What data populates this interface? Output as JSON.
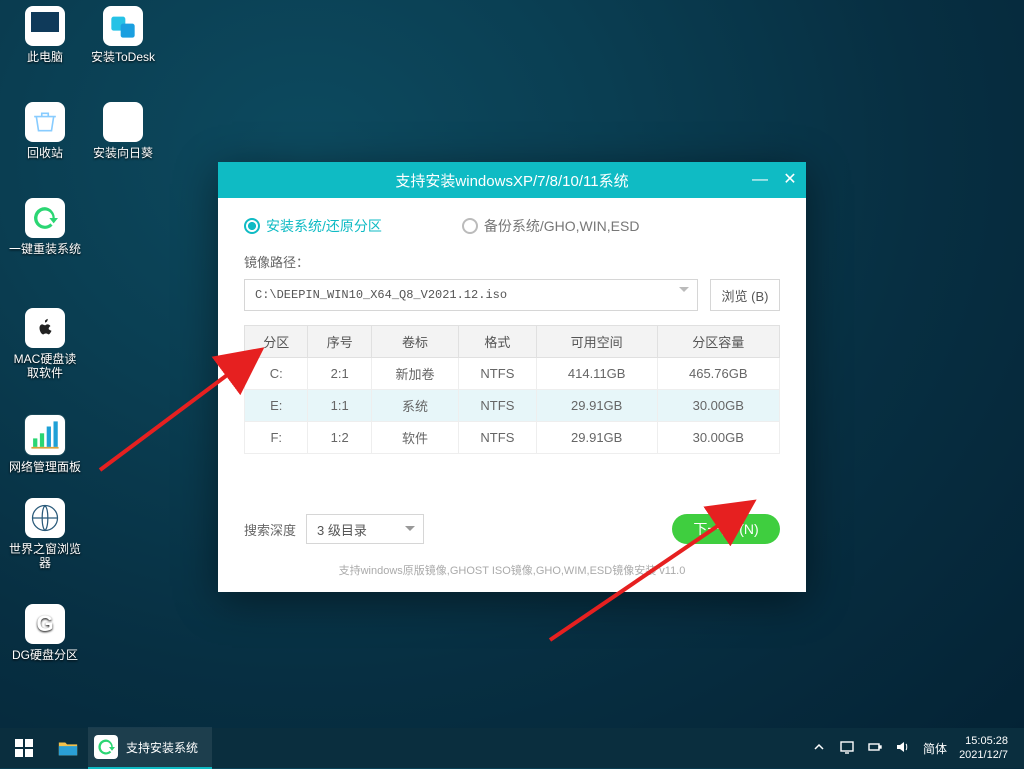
{
  "desktop_icons": [
    {
      "id": "pc",
      "label": "此电脑"
    },
    {
      "id": "todesk",
      "label": "安装ToDesk"
    },
    {
      "id": "recycle",
      "label": "回收站"
    },
    {
      "id": "sunflower",
      "label": "安装向日葵"
    },
    {
      "id": "reinstall",
      "label": "一键重装系统"
    },
    {
      "id": "machd",
      "label": "MAC硬盘读\n取软件"
    },
    {
      "id": "netpanel",
      "label": "网络管理面板"
    },
    {
      "id": "world",
      "label": "世界之窗浏览\n器"
    },
    {
      "id": "dg",
      "label": "DG硬盘分区"
    }
  ],
  "window": {
    "title": "支持安装windowsXP/7/8/10/11系统",
    "radio_install": "安装系统/还原分区",
    "radio_backup": "备份系统/GHO,WIN,ESD",
    "path_label": "镜像路径：",
    "path_value": "C:\\DEEPIN_WIN10_X64_Q8_V2021.12.iso",
    "browse": "浏览 (B)",
    "cols": [
      "分区",
      "序号",
      "卷标",
      "格式",
      "可用空间",
      "分区容量"
    ],
    "rows": [
      {
        "p": "C:",
        "n": "2:1",
        "v": "新加卷",
        "f": "NTFS",
        "free": "414.11GB",
        "cap": "465.76GB"
      },
      {
        "p": "E:",
        "n": "1:1",
        "v": "系统",
        "f": "NTFS",
        "free": "29.91GB",
        "cap": "30.00GB"
      },
      {
        "p": "F:",
        "n": "1:2",
        "v": "软件",
        "f": "NTFS",
        "free": "29.91GB",
        "cap": "30.00GB"
      }
    ],
    "selected_row": 1,
    "depth_label": "搜索深度",
    "depth_value": "3 级目录",
    "next": "下一步 (N)",
    "footnote": "支持windows原版镜像,GHOST ISO镜像,GHO,WIM,ESD镜像安装  v11.0"
  },
  "taskbar": {
    "task_label": "支持安装系统",
    "ime": "简体",
    "time": "15:05:28",
    "date": "2021/12/7"
  }
}
